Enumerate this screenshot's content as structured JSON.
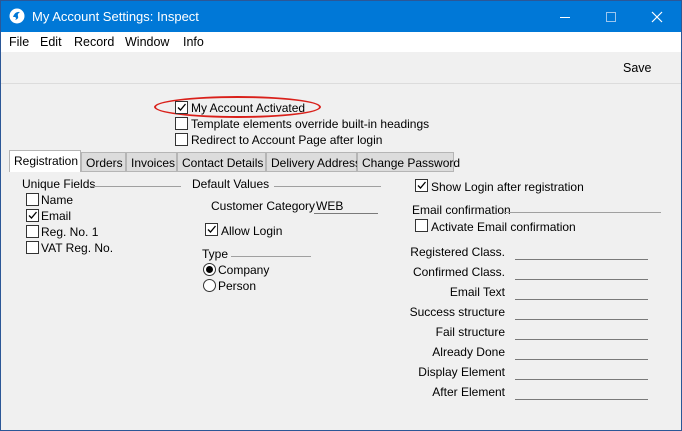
{
  "window": {
    "title": "My Account Settings: Inspect",
    "icon": "app-logo-icon"
  },
  "menu": {
    "items": [
      "File",
      "Edit",
      "Record",
      "Window",
      "Info"
    ]
  },
  "toolbar": {
    "save_label": "Save"
  },
  "options": {
    "my_account_activated": {
      "label": "My Account Activated",
      "checked": true
    },
    "template_override": {
      "label": "Template elements override built-in headings",
      "checked": false
    },
    "redirect": {
      "label": "Redirect to Account Page after login",
      "checked": false
    }
  },
  "tabs": [
    "Registration",
    "Orders",
    "Invoices",
    "Contact Details",
    "Delivery Address",
    "Change Password"
  ],
  "active_tab": "Registration",
  "registration": {
    "unique_fields": {
      "heading": "Unique Fields",
      "items": [
        {
          "label": "Name",
          "checked": false
        },
        {
          "label": "Email",
          "checked": true
        },
        {
          "label": "Reg. No. 1",
          "checked": false
        },
        {
          "label": "VAT Reg. No.",
          "checked": false
        }
      ]
    },
    "default_values": {
      "heading": "Default Values",
      "customer_category_label": "Customer Category",
      "customer_category_value": "WEB",
      "allow_login": {
        "label": "Allow Login",
        "checked": true
      },
      "type_heading": "Type",
      "type_options": [
        {
          "label": "Company",
          "selected": true
        },
        {
          "label": "Person",
          "selected": false
        }
      ]
    },
    "show_login": {
      "label": "Show Login after registration",
      "checked": true
    },
    "email_confirmation": {
      "heading": "Email confirmation",
      "activate": {
        "label": "Activate Email confirmation",
        "checked": false
      },
      "fields": [
        {
          "label": "Registered Class.",
          "value": ""
        },
        {
          "label": "Confirmed  Class.",
          "value": ""
        },
        {
          "label": "Email Text",
          "value": ""
        },
        {
          "label": "Success structure",
          "value": ""
        },
        {
          "label": "Fail structure",
          "value": ""
        },
        {
          "label": "Already Done",
          "value": ""
        },
        {
          "label": "Display Element",
          "value": ""
        },
        {
          "label": "After Element",
          "value": ""
        }
      ]
    }
  },
  "colors": {
    "titlebar": "#0078d7",
    "annotation_ring": "#d9201a",
    "panel": "#f0f0f0"
  }
}
